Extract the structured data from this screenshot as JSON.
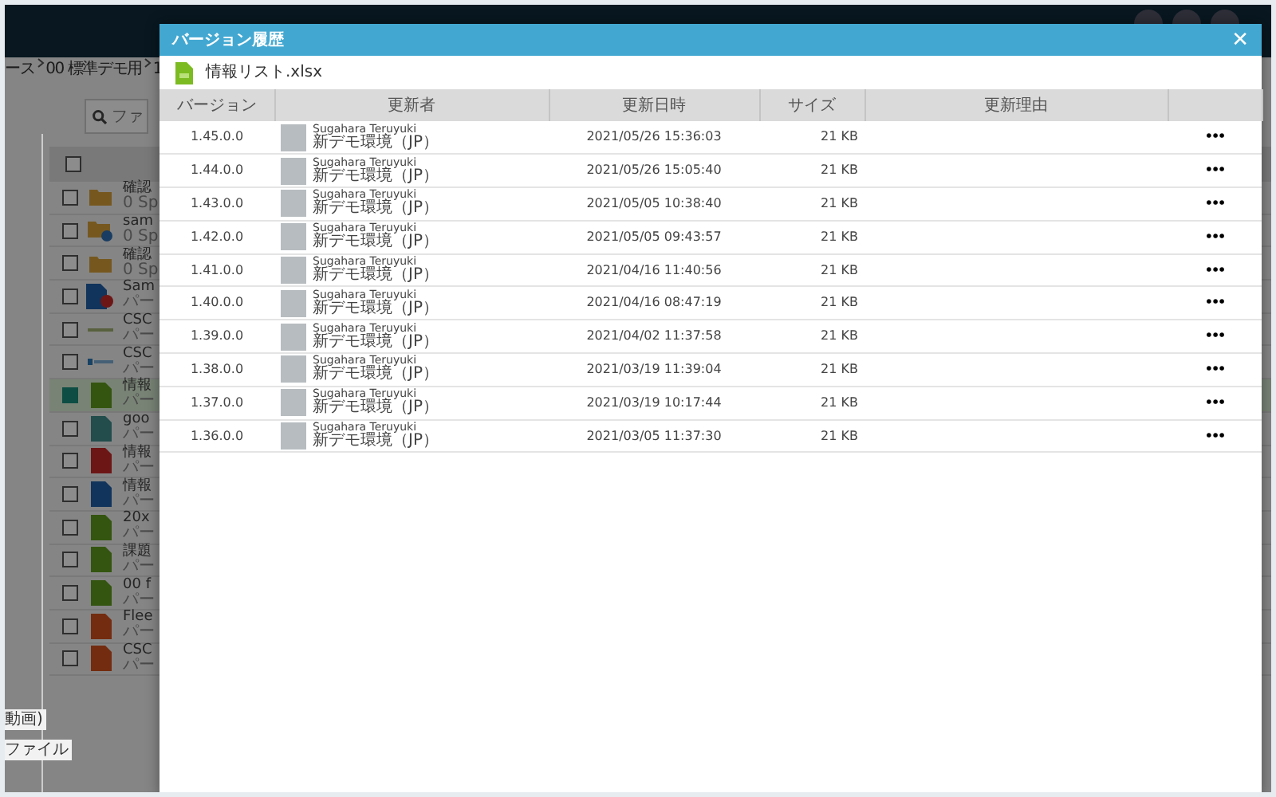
{
  "background": {
    "breadcrumb": [
      "ース",
      "00 標準デモ用",
      "1"
    ],
    "search": {
      "placeholder": "ファ"
    },
    "select_all_checked": false,
    "files": [
      {
        "kind": "folder",
        "name": "確認",
        "detail": "0 Sp",
        "checked": false
      },
      {
        "kind": "shared-folder",
        "name": "sam",
        "detail": "0 Sp",
        "checked": false
      },
      {
        "kind": "folder",
        "name": "確認",
        "detail": "0 Sp",
        "checked": false
      },
      {
        "kind": "doc-linked",
        "name": "Sam",
        "detail": "パー",
        "checked": false
      },
      {
        "kind": "logo",
        "name": "CSC",
        "detail": "パー",
        "checked": false
      },
      {
        "kind": "logo-blue",
        "name": "CSC",
        "detail": "パー",
        "checked": false
      },
      {
        "kind": "xls",
        "name": "情報",
        "detail": "パー",
        "checked": true
      },
      {
        "kind": "file",
        "name": "goo",
        "detail": "パー",
        "checked": false
      },
      {
        "kind": "pdf",
        "name": "情報",
        "detail": "パー",
        "checked": false
      },
      {
        "kind": "doc",
        "name": "情報",
        "detail": "パー",
        "checked": false
      },
      {
        "kind": "xls",
        "name": "20x",
        "detail": "パー",
        "checked": false
      },
      {
        "kind": "xls",
        "name": "課題",
        "detail": "パー",
        "checked": false
      },
      {
        "kind": "xls",
        "name": "00 f",
        "detail": "パー",
        "checked": false
      },
      {
        "kind": "ppt",
        "name": "Flee",
        "detail": "パー",
        "checked": false
      },
      {
        "kind": "ppt",
        "name": "CSC",
        "detail": "パー",
        "checked": false
      }
    ],
    "sidebar_items": [
      "動画)",
      "ファイル"
    ]
  },
  "dialog": {
    "title": "バージョン履歴",
    "close": "✕",
    "file_name": "情報リスト.xlsx",
    "columns": [
      "バージョン",
      "更新者",
      "更新日時",
      "サイズ",
      "更新理由"
    ],
    "rows": [
      {
        "version": "1.45.0.0",
        "user": "Sugahara Teruyuki",
        "org": "新デモ環境（JP）",
        "updated": "2021/05/26 15:36:03",
        "size": "21 KB",
        "menu": "•••"
      },
      {
        "version": "1.44.0.0",
        "user": "Sugahara Teruyuki",
        "org": "新デモ環境（JP）",
        "updated": "2021/05/26 15:05:40",
        "size": "21 KB",
        "menu": "•••"
      },
      {
        "version": "1.43.0.0",
        "user": "Sugahara Teruyuki",
        "org": "新デモ環境（JP）",
        "updated": "2021/05/05 10:38:40",
        "size": "21 KB",
        "menu": "•••"
      },
      {
        "version": "1.42.0.0",
        "user": "Sugahara Teruyuki",
        "org": "新デモ環境（JP）",
        "updated": "2021/05/05 09:43:57",
        "size": "21 KB",
        "menu": "•••"
      },
      {
        "version": "1.41.0.0",
        "user": "Sugahara Teruyuki",
        "org": "新デモ環境（JP）",
        "updated": "2021/04/16 11:40:56",
        "size": "21 KB",
        "menu": "•••"
      },
      {
        "version": "1.40.0.0",
        "user": "Sugahara Teruyuki",
        "org": "新デモ環境（JP）",
        "updated": "2021/04/16 08:47:19",
        "size": "21 KB",
        "menu": "•••"
      },
      {
        "version": "1.39.0.0",
        "user": "Sugahara Teruyuki",
        "org": "新デモ環境（JP）",
        "updated": "2021/04/02 11:37:58",
        "size": "21 KB",
        "menu": "•••"
      },
      {
        "version": "1.38.0.0",
        "user": "Sugahara Teruyuki",
        "org": "新デモ環境（JP）",
        "updated": "2021/03/19 11:39:04",
        "size": "21 KB",
        "menu": "•••"
      },
      {
        "version": "1.37.0.0",
        "user": "Sugahara Teruyuki",
        "org": "新デモ環境（JP）",
        "updated": "2021/03/19 10:17:44",
        "size": "21 KB",
        "menu": "•••"
      },
      {
        "version": "1.36.0.0",
        "user": "Sugahara Teruyuki",
        "org": "新デモ環境（JP）",
        "updated": "2021/03/05 11:37:30",
        "size": "21 KB",
        "menu": "•••"
      }
    ]
  }
}
